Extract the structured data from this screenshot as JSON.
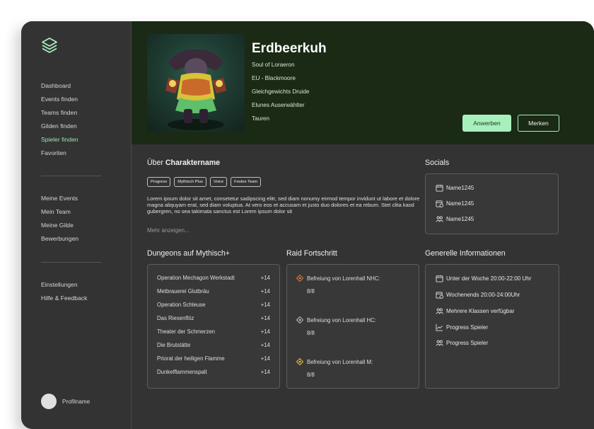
{
  "sidebar": {
    "group1": [
      "Dashboard",
      "Events finden",
      "Teams finden",
      "Gilden finden",
      "Spieler finden",
      "Favoriten"
    ],
    "active_item": "Spieler finden",
    "group2": [
      "Meine Events",
      "Mein Team",
      "Meine Gilde",
      "Bewerbungen"
    ],
    "group3": [
      "Einstellungen",
      "Hilfe & Feedback"
    ],
    "profile_name": "Profilname"
  },
  "header": {
    "name": "Erdbeerkuh",
    "lines": [
      "Soul of Loraeron",
      "EU - Blackmoore",
      "Gleichgewichts Druide",
      "Elunes Auserwählter",
      "Tauren"
    ],
    "apply_label": "Anwerben",
    "bookmark_label": "Merken"
  },
  "about": {
    "title_prefix": "Über ",
    "title_bold": "Charaktername",
    "tags": [
      "Progress",
      "Mythisch Plus",
      "Voice",
      "Festes Team"
    ],
    "text": "Lorem ipsum dolor sit amet, consetetur sadipscing elitr, sed diam nonumy eirmod tempor invidunt ut labore et dolore magna aliquyam erat, sed diam voluptua. At vero eos et accusam et justo duo dolores et ea rebum. Stet clita kasd gubergren, no sea takimata sanctus est Lorem ipsum dolor sit",
    "more_label": "Mehr anzeigen..."
  },
  "socials": {
    "title": "Socials",
    "items": [
      "Name1245",
      "Name1245",
      "Name1245"
    ]
  },
  "dungeons": {
    "title": "Dungeons auf Mythisch+",
    "rows": [
      {
        "name": "Operation Mechagon Werkstadt",
        "level": "+14"
      },
      {
        "name": "Metbrauerei Glutbräu",
        "level": "+14"
      },
      {
        "name": "Operation Schleuse",
        "level": "+14"
      },
      {
        "name": "Das Riesenflöz",
        "level": "+14"
      },
      {
        "name": "Theater der Schmerzen",
        "level": "+14"
      },
      {
        "name": "Die Brutstätte",
        "level": "+14"
      },
      {
        "name": "Priorat der heiligen Flamme",
        "level": "+14"
      },
      {
        "name": "Dunkelflammenspalt",
        "level": "+14"
      }
    ]
  },
  "raid": {
    "title": "Raid Fortschritt",
    "rows": [
      {
        "name": "Befreiung von Lorenhall NHC:",
        "progress": "8/8",
        "color": "#e07b3c"
      },
      {
        "name": "Befreiung von Lorenhall HC:",
        "progress": "8/8",
        "color": "#bdbdbd"
      },
      {
        "name": "Befreiung von Lorenhall M:",
        "progress": "8/8",
        "color": "#e8c23a"
      }
    ]
  },
  "info": {
    "title": "Generelle Informationen",
    "rows": [
      {
        "icon": "calendar-icon",
        "text": "Unter der Woche 20:00-22:00 Uhr"
      },
      {
        "icon": "calendar-clock-icon",
        "text": "Wochenends 20:00-24:00Uhr"
      },
      {
        "icon": "group-icon",
        "text": "Mehrere Klassen verfügbar"
      },
      {
        "icon": "chart-line-icon",
        "text": "Progress Spieler"
      },
      {
        "icon": "group-icon",
        "text": "Progress Spieler"
      }
    ]
  },
  "colors": {
    "accent": "#a7f0bd",
    "header_bg": "#1a2a14",
    "panel_bg": "#333333"
  }
}
